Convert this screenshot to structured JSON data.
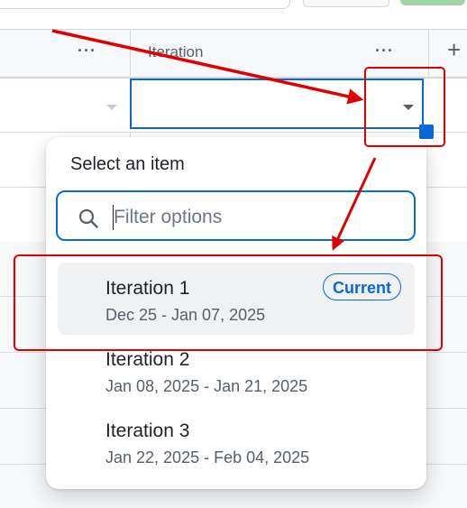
{
  "table": {
    "column_header": "Iteration",
    "more_icon": "···",
    "add_icon": "+"
  },
  "dropdown": {
    "title": "Select an item",
    "filter_placeholder": "Filter options",
    "items": [
      {
        "name": "Iteration 1",
        "dates": "Dec 25 - Jan 07, 2025",
        "badge": "Current"
      },
      {
        "name": "Iteration 2",
        "dates": "Jan 08, 2025 - Jan 21, 2025"
      },
      {
        "name": "Iteration 3",
        "dates": "Jan 22, 2025 - Feb 04, 2025"
      }
    ]
  },
  "colors": {
    "accent": "#0969da",
    "annotation": "#e00000"
  }
}
